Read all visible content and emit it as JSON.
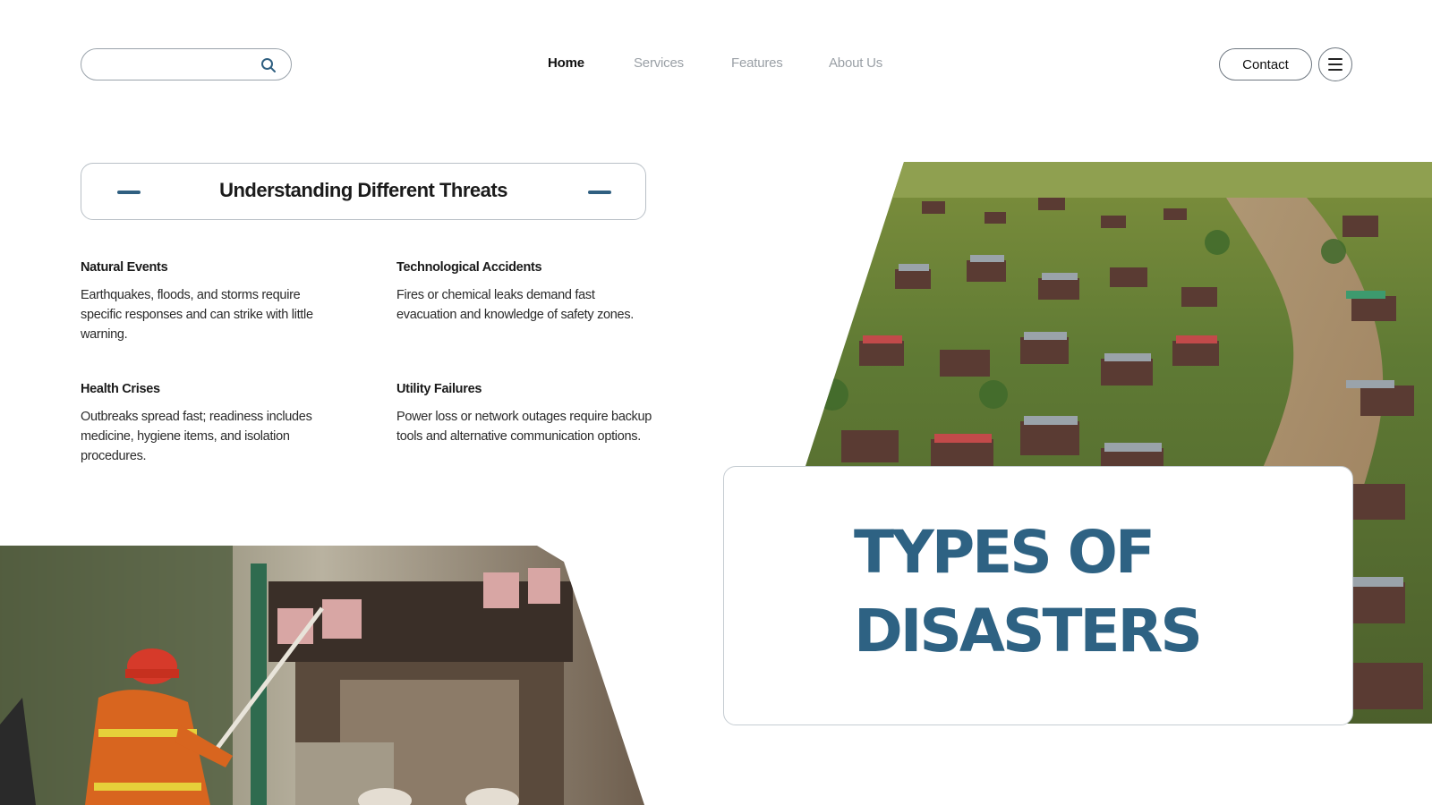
{
  "header": {
    "search": {
      "value": "",
      "placeholder": ""
    },
    "nav": [
      {
        "label": "Home",
        "active": true
      },
      {
        "label": "Services",
        "active": false
      },
      {
        "label": "Features",
        "active": false
      },
      {
        "label": "About Us",
        "active": false
      }
    ],
    "contact_label": "Contact",
    "icons": {
      "search": "search-icon",
      "menu": "hamburger-menu-icon"
    }
  },
  "section": {
    "heading": "Understanding Different Threats",
    "accent_color": "#2f5f80",
    "items": [
      {
        "title": "Natural Events",
        "text": "Earthquakes, floods, and storms require specific responses and can strike with little warning."
      },
      {
        "title": "Technological Accidents",
        "text": "Fires or chemical leaks demand fast evacuation and knowledge of safety zones."
      },
      {
        "title": "Health Crises",
        "text": "Outbreaks spread fast; readiness includes medicine, hygiene items, and isolation procedures."
      },
      {
        "title": "Utility Failures",
        "text": "Power loss or network outages require backup tools and alternative communication options."
      }
    ]
  },
  "hero": {
    "title_line1": "TYPES OF",
    "title_line2": "DISASTERS",
    "title_color": "#2e6283"
  },
  "images": {
    "top_right": "aerial-photo-flooded-riverside-village",
    "bottom_left": "photo-firefighter-spraying-water-on-burning-building"
  }
}
